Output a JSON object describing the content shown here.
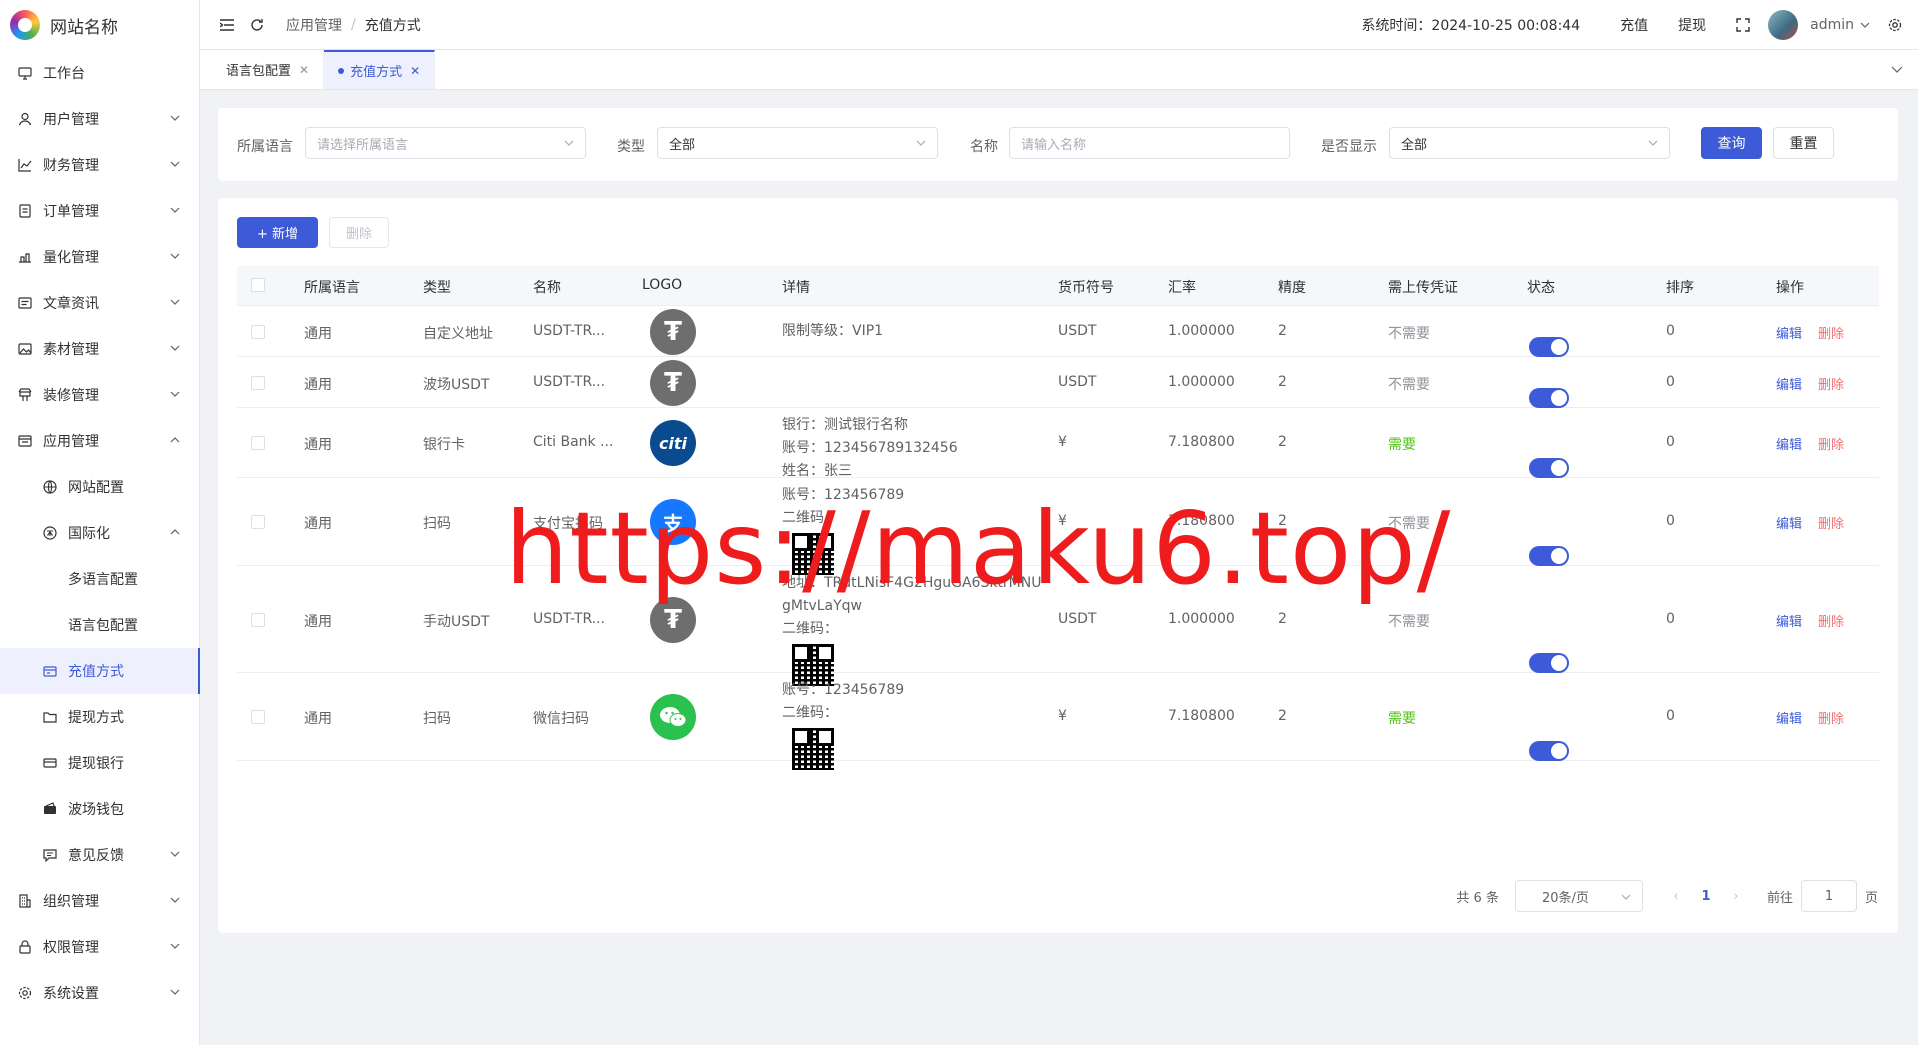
{
  "site": {
    "name": "网站名称"
  },
  "sidebar": {
    "items": [
      {
        "label": "工作台",
        "icon": "monitor-icon"
      },
      {
        "label": "用户管理",
        "icon": "user-icon"
      },
      {
        "label": "财务管理",
        "icon": "chart-icon"
      },
      {
        "label": "订单管理",
        "icon": "order-icon"
      },
      {
        "label": "量化管理",
        "icon": "quant-icon"
      },
      {
        "label": "文章资讯",
        "icon": "article-icon"
      },
      {
        "label": "素材管理",
        "icon": "image-icon"
      },
      {
        "label": "装修管理",
        "icon": "decor-icon"
      },
      {
        "label": "应用管理",
        "icon": "app-icon"
      },
      {
        "label": "网站配置",
        "icon": "globe-icon"
      },
      {
        "label": "国际化",
        "icon": "language-icon"
      },
      {
        "label": "多语言配置"
      },
      {
        "label": "语言包配置"
      },
      {
        "label": "充值方式",
        "icon": "recharge-icon"
      },
      {
        "label": "提现方式",
        "icon": "folder-icon"
      },
      {
        "label": "提现银行",
        "icon": "card-icon"
      },
      {
        "label": "波场钱包",
        "icon": "wallet-icon"
      },
      {
        "label": "意见反馈",
        "icon": "feedback-icon"
      },
      {
        "label": "组织管理",
        "icon": "org-icon"
      },
      {
        "label": "权限管理",
        "icon": "lock-icon"
      },
      {
        "label": "系统设置",
        "icon": "gear-icon"
      }
    ]
  },
  "header": {
    "breadcrumb": [
      "应用管理",
      "充值方式"
    ],
    "sys_time": "系统时间：2024-10-25 00:08:44",
    "recharge": "充值",
    "withdraw": "提现",
    "user": "admin"
  },
  "tabs": [
    {
      "label": "语言包配置",
      "active": false
    },
    {
      "label": "充值方式",
      "active": true
    }
  ],
  "filters": {
    "language_label": "所属语言",
    "language_placeholder": "请选择所属语言",
    "type_label": "类型",
    "type_value": "全部",
    "name_label": "名称",
    "name_placeholder": "请输入名称",
    "show_label": "是否显示",
    "show_value": "全部",
    "query": "查询",
    "reset": "重置"
  },
  "toolbar": {
    "add": "+ 新增",
    "delete": "删除"
  },
  "table": {
    "columns": [
      "所属语言",
      "类型",
      "名称",
      "LOGO",
      "详情",
      "货币符号",
      "汇率",
      "精度",
      "需上传凭证",
      "状态",
      "排序",
      "操作"
    ],
    "edit": "编辑",
    "del": "删除",
    "rows": [
      {
        "lang": "通用",
        "type": "自定义地址",
        "name": "USDT-TR...",
        "logo": "tether",
        "detail": [
          "限制等级：VIP1"
        ],
        "qr": false,
        "symbol": "USDT",
        "rate": "1.000000",
        "precision": "2",
        "voucher": "不需要",
        "sort": "0"
      },
      {
        "lang": "通用",
        "type": "波场USDT",
        "name": "USDT-TR...",
        "logo": "tether",
        "detail": [],
        "qr": false,
        "symbol": "USDT",
        "rate": "1.000000",
        "precision": "2",
        "voucher": "不需要",
        "sort": "0"
      },
      {
        "lang": "通用",
        "type": "银行卡",
        "name": "Citi Bank ...",
        "logo": "citi",
        "detail": [
          "银行：测试银行名称",
          "账号：123456789132456",
          "姓名：张三"
        ],
        "qr": false,
        "symbol": "¥",
        "rate": "7.180800",
        "precision": "2",
        "voucher": "需要",
        "sort": "0"
      },
      {
        "lang": "通用",
        "type": "扫码",
        "name": "支付宝扫码",
        "logo": "alipay",
        "detail": [
          "账号：123456789",
          "二维码："
        ],
        "qr": true,
        "symbol": "¥",
        "rate": "7.180800",
        "precision": "2",
        "voucher": "不需要",
        "sort": "0"
      },
      {
        "lang": "通用",
        "type": "手动USDT",
        "name": "USDT-TR...",
        "logo": "tether",
        "detail": [
          "地址：TRdtLNisF4G2HguGA6SktrMNU",
          "gMtvLaYqw",
          "二维码："
        ],
        "qr": true,
        "symbol": "USDT",
        "rate": "1.000000",
        "precision": "2",
        "voucher": "不需要",
        "sort": "0"
      },
      {
        "lang": "通用",
        "type": "扫码",
        "name": "微信扫码",
        "logo": "wechat",
        "detail": [
          "账号：123456789",
          "二维码："
        ],
        "qr": true,
        "symbol": "¥",
        "rate": "7.180800",
        "precision": "2",
        "voucher": "需要",
        "sort": "0"
      }
    ]
  },
  "pagination": {
    "total": "共 6 条",
    "size": "20条/页",
    "current": "1",
    "goto": "前往",
    "goto_value": "1",
    "page": "页"
  },
  "watermark": "https://maku6.top/",
  "colors": {
    "primary": "#3d5bd8",
    "danger": "#f56c6c",
    "success": "#52c41a",
    "watermark": "#ee1c1c"
  }
}
